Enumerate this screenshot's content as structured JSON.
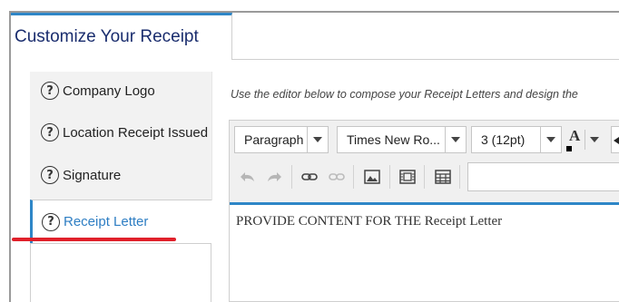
{
  "header": {
    "title": "Customize Your Receipt"
  },
  "sidebar": {
    "items": [
      {
        "label": "Company Logo"
      },
      {
        "label": "Location Receipt Issued"
      },
      {
        "label": "Signature"
      },
      {
        "label": "Receipt Letter"
      }
    ],
    "help_glyph": "?"
  },
  "main": {
    "instructions": "Use the editor below to compose your Receipt Letters and design the"
  },
  "editor": {
    "toolbar": {
      "format_select": "Paragraph",
      "font_select": "Times New Ro...",
      "size_select": "3 (12pt)",
      "text_color_glyph": "A"
    },
    "content": "PROVIDE CONTENT FOR THE Receipt Letter"
  },
  "colors": {
    "accent": "#2e86c7",
    "title": "#1a2d6e",
    "highlight": "#e0202a"
  },
  "icons": [
    "help-circle-icon",
    "undo-icon",
    "redo-icon",
    "link-icon",
    "unlink-icon",
    "image-icon",
    "video-icon",
    "table-icon",
    "text-color-icon"
  ]
}
